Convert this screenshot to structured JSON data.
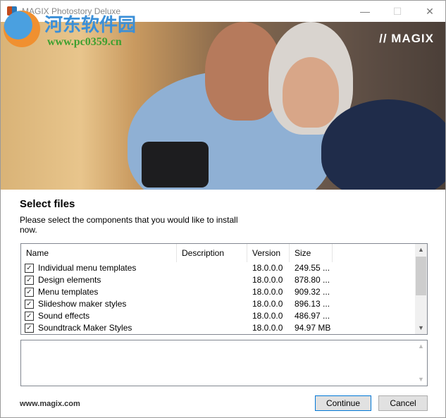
{
  "window": {
    "title": "MAGIX Photostory Deluxe",
    "minimize": "—",
    "maximize": "☐",
    "close": "✕"
  },
  "banner": {
    "brand": "// MAGIX"
  },
  "watermark": {
    "cn": "河东软件园",
    "url": "www.pc0359.cn"
  },
  "heading": "Select files",
  "description": "Please select the components that you would like to install now.",
  "table": {
    "columns": [
      "Name",
      "Description",
      "Version",
      "Size"
    ],
    "rows": [
      {
        "name": "Individual menu templates",
        "description": "",
        "version": "18.0.0.0",
        "size": "249.55 ...",
        "checked": true
      },
      {
        "name": "Design elements",
        "description": "",
        "version": "18.0.0.0",
        "size": "878.80 ...",
        "checked": true
      },
      {
        "name": "Menu templates",
        "description": "",
        "version": "18.0.0.0",
        "size": "909.32 ...",
        "checked": true
      },
      {
        "name": "Slideshow maker styles",
        "description": "",
        "version": "18.0.0.0",
        "size": "896.13 ...",
        "checked": true
      },
      {
        "name": "Sound effects",
        "description": "",
        "version": "18.0.0.0",
        "size": "486.97 ...",
        "checked": true
      },
      {
        "name": "Soundtrack Maker Styles",
        "description": "",
        "version": "18.0.0.0",
        "size": "94.97 MB",
        "checked": true
      }
    ]
  },
  "footer": {
    "website": "www.magix.com",
    "continue": "Continue",
    "cancel": "Cancel"
  }
}
